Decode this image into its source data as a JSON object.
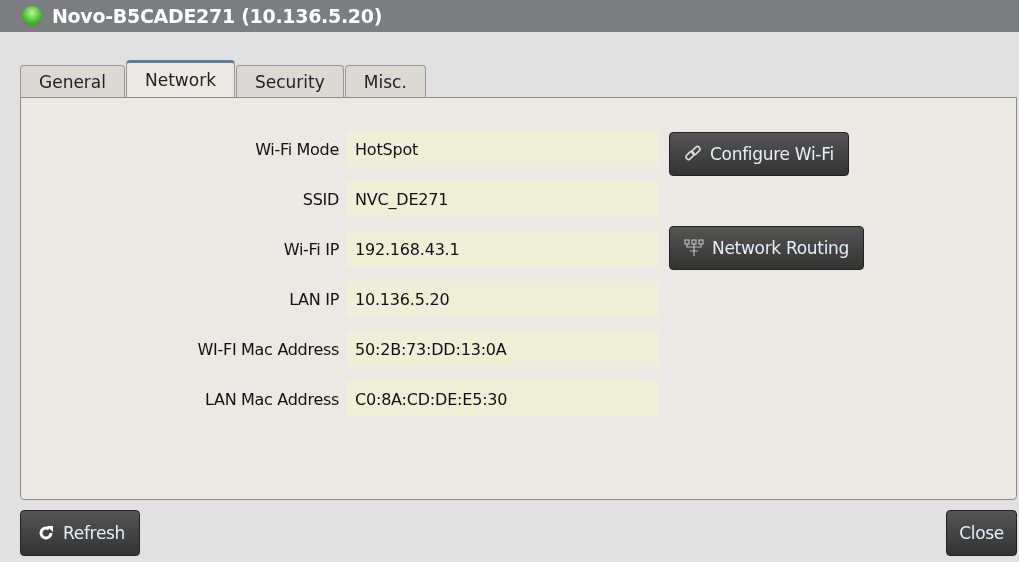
{
  "window": {
    "title": "Novo-B5CADE271 (10.136.5.20)",
    "online": true
  },
  "tabs": [
    {
      "label": "General",
      "selected": false
    },
    {
      "label": "Network",
      "selected": true
    },
    {
      "label": "Security",
      "selected": false
    },
    {
      "label": "Misc."
    }
  ],
  "fields": [
    {
      "label": "Wi-Fi Mode",
      "value": "HotSpot"
    },
    {
      "label": "SSID",
      "value": "NVC_DE271"
    },
    {
      "label": "Wi-Fi IP",
      "value": "192.168.43.1"
    },
    {
      "label": "LAN IP",
      "value": "10.136.5.20"
    },
    {
      "label": "WI-FI Mac Address",
      "value": "50:2B:73:DD:13:0A"
    },
    {
      "label": "LAN Mac Address",
      "value": "C0:8A:CD:DE:E5:30"
    }
  ],
  "actions": [
    {
      "label": "Configure Wi-Fi",
      "kind": "link"
    },
    {
      "label": "Network Routing",
      "kind": "routing"
    }
  ],
  "footer": {
    "refresh": "Refresh",
    "close": "Close"
  }
}
